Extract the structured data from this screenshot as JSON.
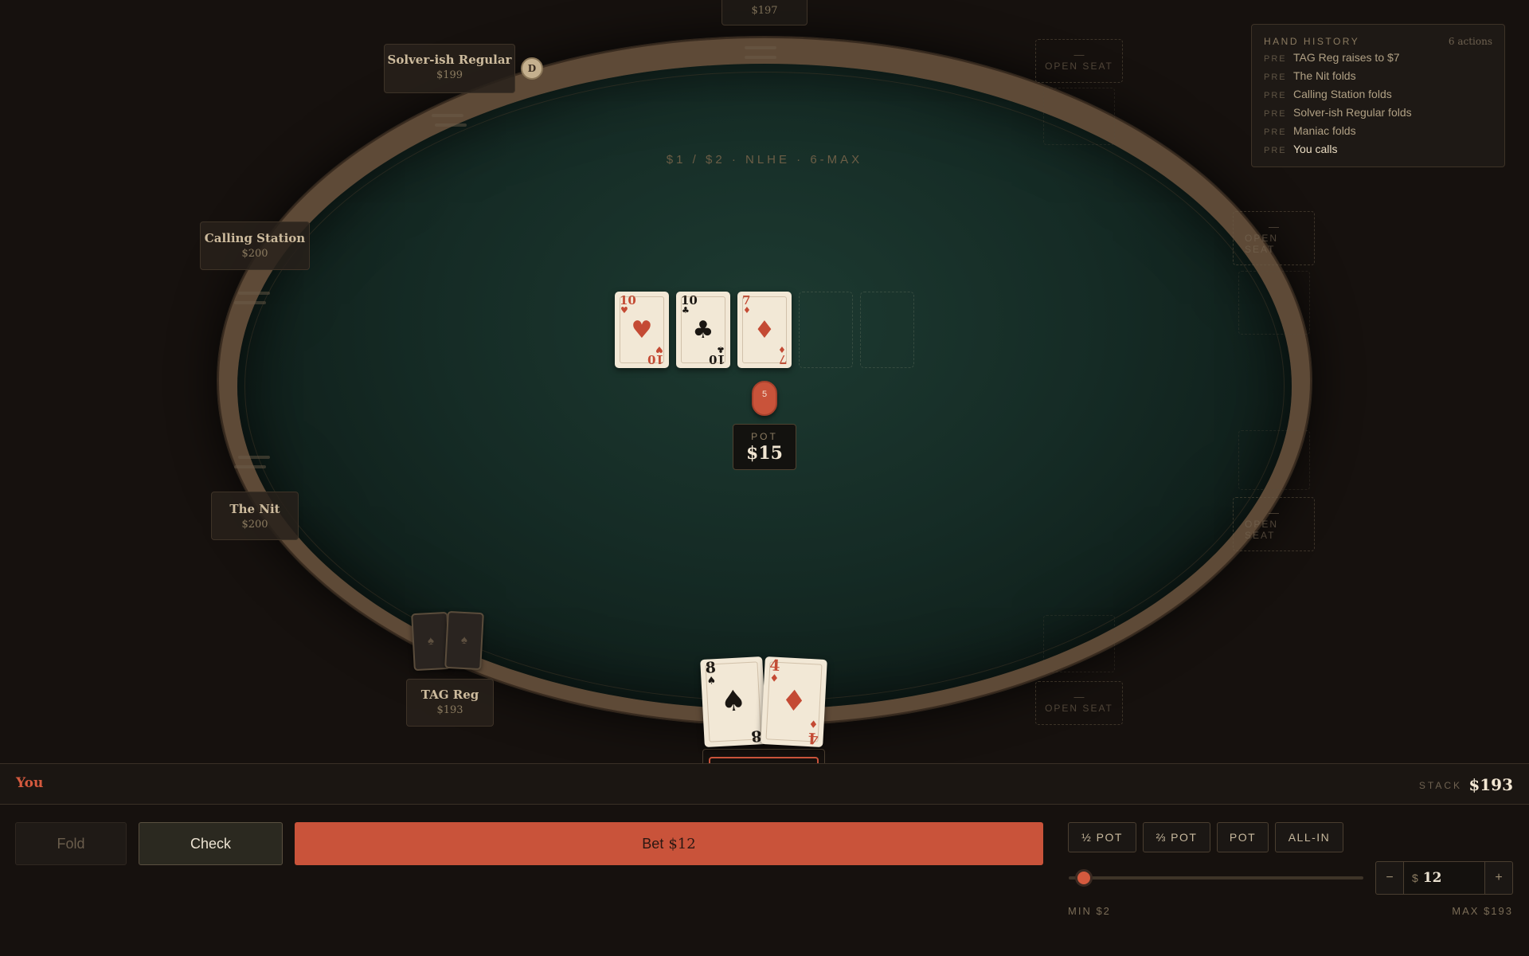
{
  "table": {
    "stakes": "$1 / $2 · NLHE · 6-MAX"
  },
  "board": {
    "cards": [
      {
        "rank": "10",
        "suit": "♥",
        "color": "red"
      },
      {
        "rank": "10",
        "suit": "♣",
        "color": "black"
      },
      {
        "rank": "7",
        "suit": "♦",
        "color": "red"
      }
    ],
    "empty_slots": 2
  },
  "pot": {
    "chip": "5",
    "label": "POT",
    "amount": "$15"
  },
  "seats": {
    "top_stub_stack": "$197",
    "solver": {
      "name": "Solver-ish Regular",
      "stack": "$199",
      "dealer": "D"
    },
    "calling": {
      "name": "Calling Station",
      "stack": "$200"
    },
    "nit": {
      "name": "The Nit",
      "stack": "$200"
    },
    "tag": {
      "name": "TAG Reg",
      "stack": "$193",
      "back_suit": "♠"
    },
    "open_seat_dash": "—",
    "open_seat_label": "OPEN SEAT",
    "open_seat_label_line1": "OPEN",
    "open_seat_label_line2": "SEAT"
  },
  "hero": {
    "name": "You",
    "stack_label": "STACK",
    "stack": "$193",
    "hole": [
      {
        "rank": "8",
        "suit": "♠",
        "color": "black"
      },
      {
        "rank": "4",
        "suit": "♦",
        "color": "red"
      }
    ]
  },
  "history": {
    "title": "HAND HISTORY",
    "count": "6 actions",
    "rows": [
      {
        "street": "PRE",
        "text": "TAG Reg raises to $7"
      },
      {
        "street": "PRE",
        "text": "The Nit folds"
      },
      {
        "street": "PRE",
        "text": "Calling Station folds"
      },
      {
        "street": "PRE",
        "text": "Solver-ish Regular folds"
      },
      {
        "street": "PRE",
        "text": "Maniac folds"
      },
      {
        "street": "PRE",
        "text": "You calls"
      }
    ]
  },
  "actions": {
    "fold": "Fold",
    "check": "Check",
    "bet_label": "Bet",
    "bet_amount": "$12",
    "presets": [
      "½ POT",
      "⅔ POT",
      "POT",
      "ALL-IN"
    ],
    "currency": "$",
    "bet_value": "12",
    "minus": "−",
    "plus": "+",
    "min_label": "MIN $2",
    "max_label": "MAX $193",
    "slider_fraction": 0.052
  },
  "colors": {
    "accent": "#c9533a",
    "felt": "#152b25",
    "rail": "#5e4a37"
  }
}
